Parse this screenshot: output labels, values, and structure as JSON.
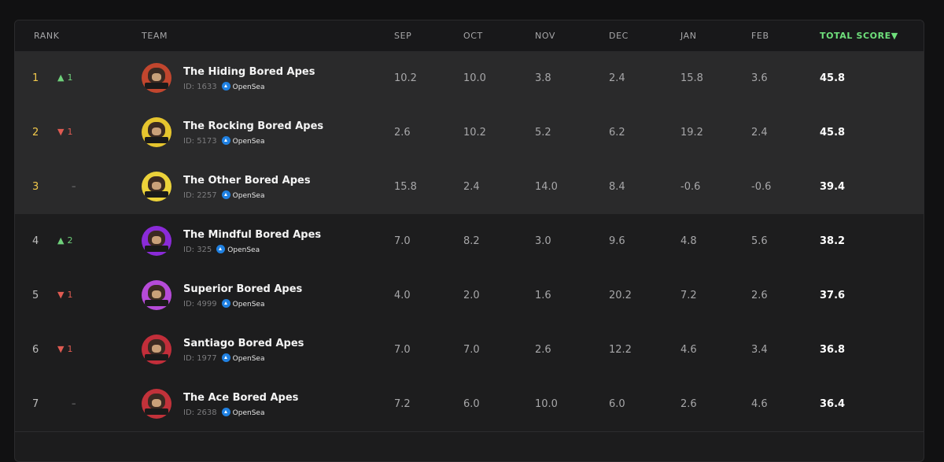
{
  "headers": {
    "rank": "RANK",
    "team": "TEAM",
    "sep": "SEP",
    "oct": "OCT",
    "nov": "NOV",
    "dec": "DEC",
    "jan": "JAN",
    "feb": "FEB",
    "total": "TOTAL SCORE▼"
  },
  "colors": {
    "accent_total": "#6fe07c",
    "rank_top": "#f2c94c",
    "up": "#6fd17b",
    "down": "#e05b52",
    "opensea": "#2081e2"
  },
  "rows": [
    {
      "rank": "1",
      "change": "up",
      "change_val": "1",
      "name": "The Hiding Bored Apes",
      "id": "ID: 1633",
      "market": "OpenSea",
      "sep": "10.2",
      "oct": "10.0",
      "nov": "3.8",
      "dec": "2.4",
      "jan": "15.8",
      "feb": "3.6",
      "total": "45.8",
      "avatar_color": "#c2462e"
    },
    {
      "rank": "2",
      "change": "down",
      "change_val": "1",
      "name": "The Rocking Bored Apes",
      "id": "ID: 5173",
      "market": "OpenSea",
      "sep": "2.6",
      "oct": "10.2",
      "nov": "5.2",
      "dec": "6.2",
      "jan": "19.2",
      "feb": "2.4",
      "total": "45.8",
      "avatar_color": "#e6c52e"
    },
    {
      "rank": "3",
      "change": "flat",
      "change_val": "–",
      "name": "The Other Bored Apes",
      "id": "ID: 2257",
      "market": "OpenSea",
      "sep": "15.8",
      "oct": "2.4",
      "nov": "14.0",
      "dec": "8.4",
      "jan": "-0.6",
      "feb": "-0.6",
      "total": "39.4",
      "avatar_color": "#ecd23a"
    },
    {
      "rank": "4",
      "change": "up",
      "change_val": "2",
      "name": "The Mindful Bored Apes",
      "id": "ID: 325",
      "market": "OpenSea",
      "sep": "7.0",
      "oct": "8.2",
      "nov": "3.0",
      "dec": "9.6",
      "jan": "4.8",
      "feb": "5.6",
      "total": "38.2",
      "avatar_color": "#8a2bd8"
    },
    {
      "rank": "5",
      "change": "down",
      "change_val": "1",
      "name": "Superior Bored Apes",
      "id": "ID: 4999",
      "market": "OpenSea",
      "sep": "4.0",
      "oct": "2.0",
      "nov": "1.6",
      "dec": "20.2",
      "jan": "7.2",
      "feb": "2.6",
      "total": "37.6",
      "avatar_color": "#b64bd8"
    },
    {
      "rank": "6",
      "change": "down",
      "change_val": "1",
      "name": "Santiago Bored Apes",
      "id": "ID: 1977",
      "market": "OpenSea",
      "sep": "7.0",
      "oct": "7.0",
      "nov": "2.6",
      "dec": "12.2",
      "jan": "4.6",
      "feb": "3.4",
      "total": "36.8",
      "avatar_color": "#c22e3a"
    },
    {
      "rank": "7",
      "change": "flat",
      "change_val": "–",
      "name": "The Ace Bored Apes",
      "id": "ID: 2638",
      "market": "OpenSea",
      "sep": "7.2",
      "oct": "6.0",
      "nov": "10.0",
      "dec": "6.0",
      "jan": "2.6",
      "feb": "4.6",
      "total": "36.4",
      "avatar_color": "#c2323a"
    }
  ]
}
